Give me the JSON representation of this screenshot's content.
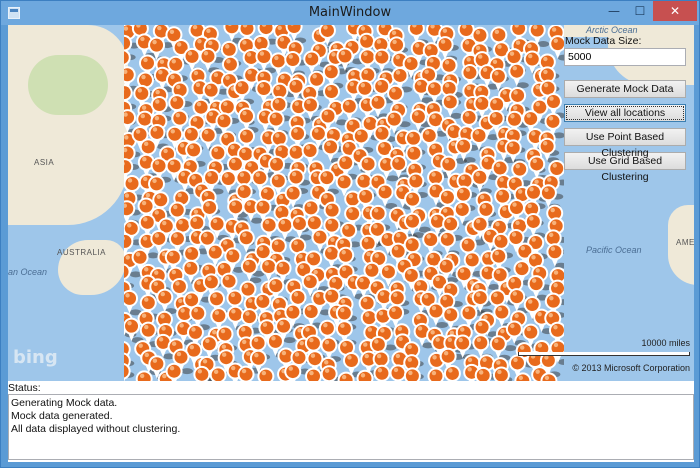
{
  "window": {
    "title": "MainWindow",
    "controls": {
      "minimize": "—",
      "maximize": "☐",
      "close": "✕"
    }
  },
  "map": {
    "labels": {
      "asia": "ASIA",
      "australia": "AUSTRALIA",
      "indian_ocean": "an Ocean",
      "pacific_ocean": "Pacific Ocean",
      "arctic_ocean": "Arctic Ocean",
      "america_partial": "AME"
    },
    "brand": "bing",
    "scale_text": "10000 miles",
    "copyright": "© 2013 Microsoft Corporation",
    "pin_color": "#e86a1c"
  },
  "panel": {
    "mock_data_label": "Mock Data Size:",
    "mock_data_value": "5000",
    "buttons": {
      "generate": "Generate Mock Data",
      "view_all": "View all locations",
      "point_clustering": "Use Point Based Clustering",
      "grid_clustering": "Use Grid Based Clustering"
    }
  },
  "status": {
    "label": "Status:",
    "lines": [
      "Generating Mock data.",
      "Mock data generated.",
      "All data displayed without clustering."
    ]
  }
}
